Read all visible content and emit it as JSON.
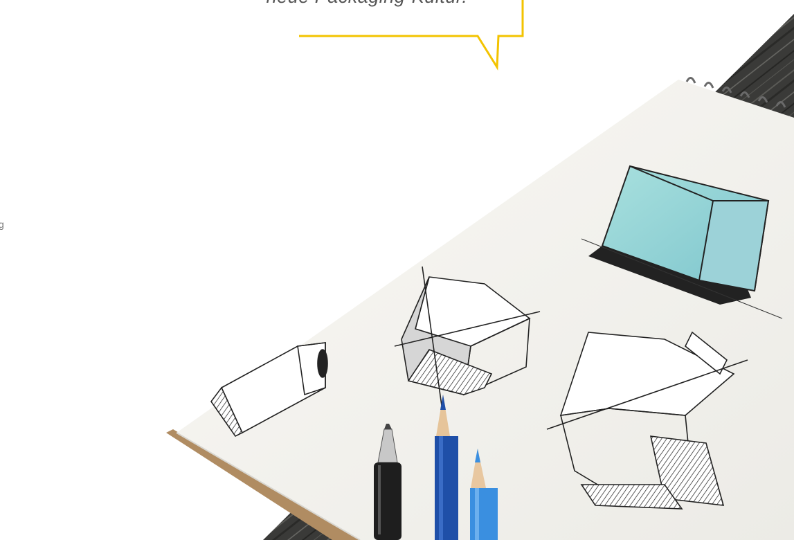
{
  "quote": {
    "text": "neue Packaging-Kultur.",
    "accent_color": "#f3c300"
  },
  "left_fragment": {
    "text": "g"
  },
  "photo": {
    "wood_color": "#3a3a38",
    "paper_color": "#f5f4f0",
    "box_fill_color": "#9fd6d8",
    "pencil_blue_dark": "#1f4fa8",
    "pencil_blue_light": "#3a8fe0",
    "pen_body_color": "#222222"
  }
}
